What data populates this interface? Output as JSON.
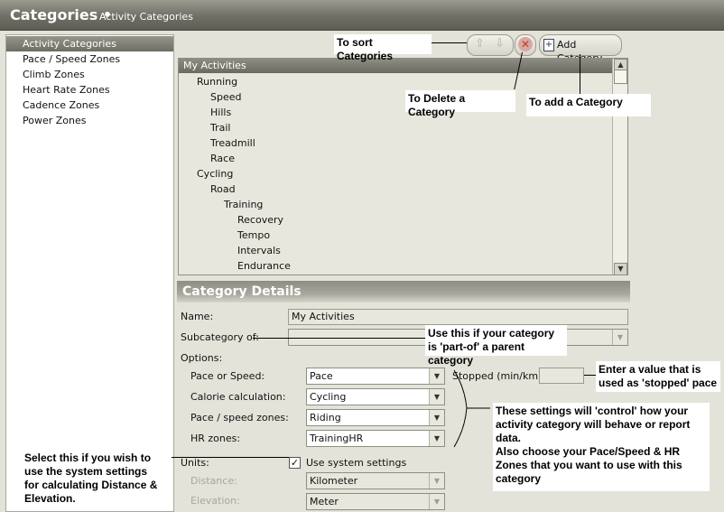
{
  "titlebar": {
    "title": "Categories",
    "separator": "•",
    "subtitle": "Activity Categories"
  },
  "sidebar": {
    "items": [
      {
        "label": "Activity Categories",
        "selected": true
      },
      {
        "label": "Pace / Speed Zones",
        "selected": false
      },
      {
        "label": "Climb Zones",
        "selected": false
      },
      {
        "label": "Heart Rate Zones",
        "selected": false
      },
      {
        "label": "Cadence Zones",
        "selected": false
      },
      {
        "label": "Power Zones",
        "selected": false
      }
    ]
  },
  "toolbar": {
    "add_category_label": "Add Category",
    "icons": {
      "up": "up-arrow-icon",
      "down": "down-arrow-icon",
      "delete": "delete-icon",
      "add": "add-category-icon"
    }
  },
  "tree": {
    "root": "My Activities",
    "rows": [
      {
        "label": "Running",
        "level": 1
      },
      {
        "label": "Speed",
        "level": 2
      },
      {
        "label": "Hills",
        "level": 2
      },
      {
        "label": "Trail",
        "level": 2
      },
      {
        "label": "Treadmill",
        "level": 2
      },
      {
        "label": "Race",
        "level": 2
      },
      {
        "label": "Cycling",
        "level": 1
      },
      {
        "label": "Road",
        "level": 2
      },
      {
        "label": "Training",
        "level": 3
      },
      {
        "label": "Recovery",
        "level": 4
      },
      {
        "label": "Tempo",
        "level": 4
      },
      {
        "label": "Intervals",
        "level": 4
      },
      {
        "label": "Endurance",
        "level": 4
      }
    ]
  },
  "details": {
    "header": "Category Details",
    "name_label": "Name:",
    "name_value": "My Activities",
    "subcategory_label": "Subcategory of:",
    "subcategory_value": "",
    "options_label": "Options:",
    "pace_label": "Pace or Speed:",
    "pace_value": "Pace",
    "stopped_label": "Stopped (min/km):",
    "stopped_value": "",
    "calorie_label": "Calorie calculation:",
    "calorie_value": "Cycling",
    "zones_label": "Pace / speed zones:",
    "zones_value": "Riding",
    "hr_label": "HR zones:",
    "hr_value": "TrainingHR",
    "units_label": "Units:",
    "use_system_label": "Use system settings",
    "use_system_checked": true,
    "distance_label": "Distance:",
    "distance_value": "Kilometer",
    "elevation_label": "Elevation:",
    "elevation_value": "Meter"
  },
  "callouts": {
    "sort": "To sort Categories",
    "delete": "To Delete a Category",
    "add": "To add a Category",
    "subcategory": "Use this if your category is 'part-of' a parent category",
    "stopped": "Enter a value that is used as 'stopped' pace",
    "settings": "These settings will 'control' how your activity category will behave or report data.\nAlso choose your Pace/Speed & HR Zones that you want to use with this category",
    "system": "Select this if you wish to use the system settings for calculating Distance & Elevation."
  },
  "colors": {
    "header_gradient_dark": "#6b6a61",
    "panel_bg": "#e4e3da",
    "delete_red": "#c23a2a"
  }
}
